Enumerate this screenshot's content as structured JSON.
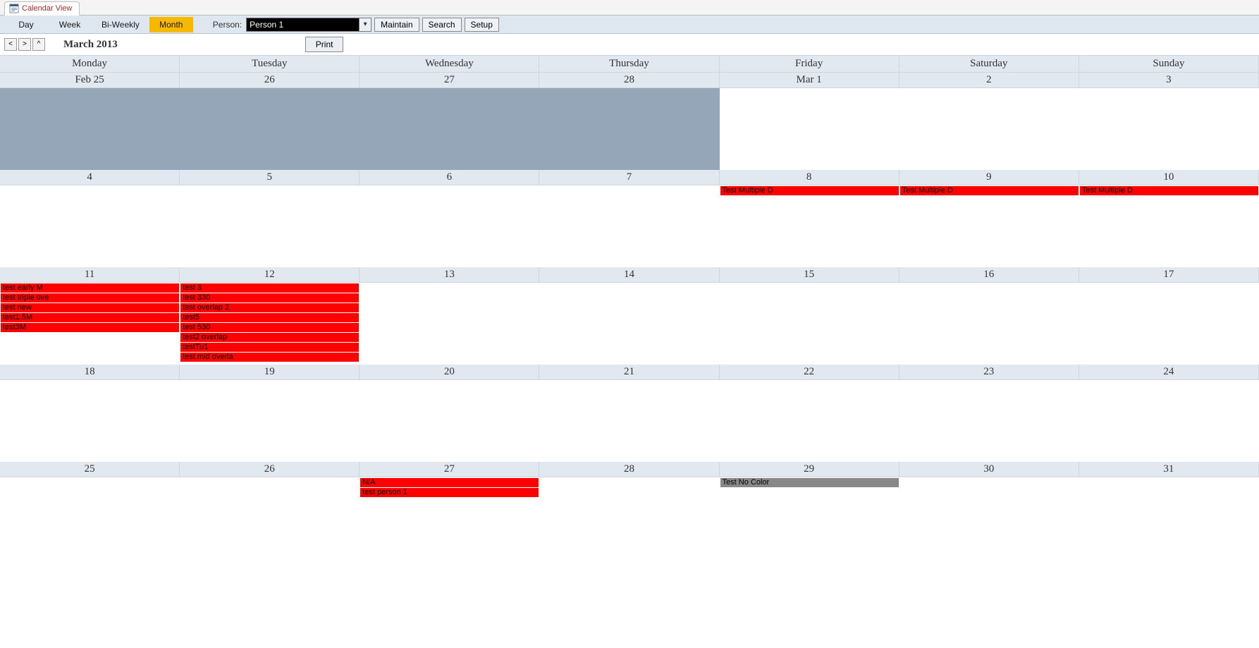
{
  "tab": {
    "title": "Calendar View"
  },
  "toolbar": {
    "views": [
      "Day",
      "Week",
      "Bi-Weekly",
      "Month"
    ],
    "active_view_index": 3,
    "person_label": "Person:",
    "person_value": "Person 1",
    "maintain": "Maintain",
    "search": "Search",
    "setup": "Setup"
  },
  "nav": {
    "prev": "<",
    "next": ">",
    "up": "^",
    "title": "March 2013",
    "print": "Print"
  },
  "days_of_week": [
    "Monday",
    "Tuesday",
    "Wednesday",
    "Thursday",
    "Friday",
    "Saturday",
    "Sunday"
  ],
  "weeks": [
    {
      "days": [
        {
          "label": "Feb 25",
          "out_month": true,
          "events": []
        },
        {
          "label": "26",
          "out_month": true,
          "events": []
        },
        {
          "label": "27",
          "out_month": true,
          "events": []
        },
        {
          "label": "28",
          "out_month": true,
          "events": []
        },
        {
          "label": "Mar 1",
          "out_month": false,
          "events": []
        },
        {
          "label": "2",
          "out_month": false,
          "events": []
        },
        {
          "label": "3",
          "out_month": false,
          "events": []
        }
      ]
    },
    {
      "days": [
        {
          "label": "4",
          "out_month": false,
          "events": []
        },
        {
          "label": "5",
          "out_month": false,
          "events": []
        },
        {
          "label": "6",
          "out_month": false,
          "events": []
        },
        {
          "label": "7",
          "out_month": false,
          "events": []
        },
        {
          "label": "8",
          "out_month": false,
          "events": [
            {
              "text": "Test Multiple D",
              "color": "red"
            }
          ]
        },
        {
          "label": "9",
          "out_month": false,
          "events": [
            {
              "text": "Test Multiple D",
              "color": "red"
            }
          ]
        },
        {
          "label": "10",
          "out_month": false,
          "events": [
            {
              "text": "Test Multiple D",
              "color": "red"
            }
          ]
        }
      ]
    },
    {
      "days": [
        {
          "label": "11",
          "out_month": false,
          "events": [
            {
              "text": "test early M",
              "color": "red"
            },
            {
              "text": "test triple ove",
              "color": "red"
            },
            {
              "text": "test new",
              "color": "red"
            },
            {
              "text": "test1.5M",
              "color": "red"
            },
            {
              "text": "test3M",
              "color": "red"
            }
          ]
        },
        {
          "label": "12",
          "out_month": false,
          "events": [
            {
              "text": "test 3",
              "color": "red"
            },
            {
              "text": "test 330",
              "color": "red"
            },
            {
              "text": "test overlap 2",
              "color": "red"
            },
            {
              "text": "test5",
              "color": "red"
            },
            {
              "text": "test 530",
              "color": "red"
            },
            {
              "text": "test2 overlap",
              "color": "red"
            },
            {
              "text": "testTu1",
              "color": "red"
            },
            {
              "text": "test mid overla",
              "color": "red"
            }
          ]
        },
        {
          "label": "13",
          "out_month": false,
          "events": []
        },
        {
          "label": "14",
          "out_month": false,
          "events": []
        },
        {
          "label": "15",
          "out_month": false,
          "events": []
        },
        {
          "label": "16",
          "out_month": false,
          "events": []
        },
        {
          "label": "17",
          "out_month": false,
          "events": []
        }
      ]
    },
    {
      "days": [
        {
          "label": "18",
          "out_month": false,
          "events": []
        },
        {
          "label": "19",
          "out_month": false,
          "events": []
        },
        {
          "label": "20",
          "out_month": false,
          "events": []
        },
        {
          "label": "21",
          "out_month": false,
          "events": []
        },
        {
          "label": "22",
          "out_month": false,
          "events": []
        },
        {
          "label": "23",
          "out_month": false,
          "events": []
        },
        {
          "label": "24",
          "out_month": false,
          "events": []
        }
      ]
    },
    {
      "days": [
        {
          "label": "25",
          "out_month": false,
          "events": []
        },
        {
          "label": "26",
          "out_month": false,
          "events": []
        },
        {
          "label": "27",
          "out_month": false,
          "events": [
            {
              "text": "N/A",
              "color": "red"
            },
            {
              "text": "test person 1",
              "color": "red"
            }
          ]
        },
        {
          "label": "28",
          "out_month": false,
          "events": []
        },
        {
          "label": "29",
          "out_month": false,
          "events": [
            {
              "text": "Test No Color",
              "color": "gray"
            }
          ]
        },
        {
          "label": "30",
          "out_month": false,
          "events": []
        },
        {
          "label": "31",
          "out_month": false,
          "events": []
        }
      ]
    }
  ]
}
